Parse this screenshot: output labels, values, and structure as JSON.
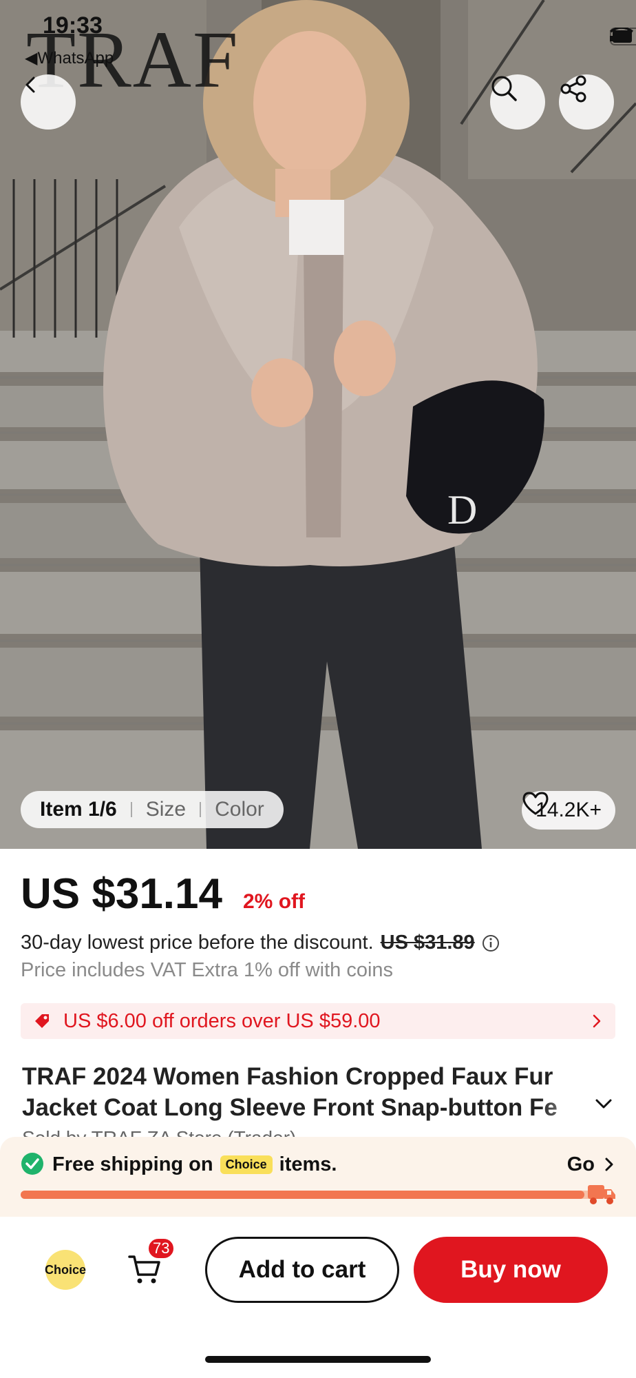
{
  "status_bar": {
    "time": "19:33",
    "back_app": "WhatsApp"
  },
  "brand": {
    "logo_text": "TRAF"
  },
  "hero": {
    "image_counter": "Item 1/6",
    "filters": [
      "Size",
      "Color"
    ],
    "like_count": "14.2K+"
  },
  "pricing": {
    "price": "US $31.14",
    "discount": "2% off",
    "lowest_text": "30-day lowest price before the discount.",
    "lowest_old_price": "US $31.89",
    "vat_text": "Price includes VAT Extra 1% off with coins"
  },
  "coupon": {
    "text": "US $6.00 off orders over US $59.00"
  },
  "product": {
    "title_line1": "TRAF 2024 Women Fashion Cropped Faux Fur",
    "title_line2": "Jacket Coat Long Sleeve Front Snap-button Fe",
    "sold_by": "Sold by TRAF ZA Store (Trader)"
  },
  "shipping": {
    "label_before": "Free shipping on",
    "choice_tag": "Choice",
    "label_after": "items.",
    "go_label": "Go",
    "progress": 0.97
  },
  "actions": {
    "choice_label": "Choice",
    "cart_count": "73",
    "add_to_cart": "Add to cart",
    "buy_now": "Buy now"
  },
  "colors": {
    "accent_red": "#e0161f",
    "choice_yellow": "#f9df5a",
    "progress_orange": "#f27650"
  }
}
